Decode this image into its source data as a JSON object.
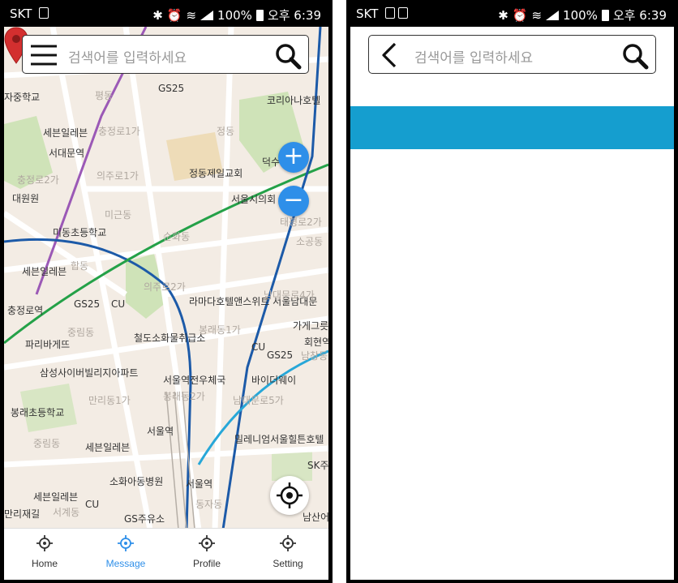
{
  "status_bar": {
    "carrier": "SKT",
    "battery": "100%",
    "time": "오후 6:39"
  },
  "left_screen": {
    "menu_icon": "hamburger-icon",
    "search_placeholder": "검색어를 입력하세요",
    "search_icon": "magnifier-icon",
    "zoom_in_label": "+",
    "zoom_out_label": "−",
    "map_labels": [
      "GS25",
      "코리아나호텔",
      "세븐일레븐",
      "서대문역",
      "정동제일교회",
      "서울시의회",
      "대원원",
      "미근동",
      "미동초등학교",
      "순화동",
      "세븐일레븐",
      "충정로역",
      "GS25",
      "CU",
      "라마다호텔앤스위트 서울남대문",
      "중림동",
      "파리바게뜨",
      "철도소화물취급소",
      "가게그릇",
      "회현역",
      "CU",
      "GS25",
      "삼성사이버빌리지아파트",
      "서울역전우체국",
      "바이더웨이",
      "만리동1가",
      "봉래초등학교",
      "서울역",
      "중림동",
      "세븐일레븐",
      "밀레니엄서울힐튼호텔",
      "소화아동병원",
      "서울역",
      "세븐일레븐",
      "CU",
      "GS주유소",
      "SK주",
      "남산어",
      "자중학교",
      "평동",
      "충정로1가",
      "정동",
      "덕수",
      "의주로1가",
      "충정로2가",
      "태평로2가",
      "소공동",
      "합동",
      "의주로2가",
      "남대문로4가",
      "봉래동1가",
      "남창동",
      "봉래동2가",
      "남대문로5가",
      "서계동",
      "동자동",
      "만리재길"
    ],
    "tabs": [
      {
        "label": "Home",
        "active": false
      },
      {
        "label": "Message",
        "active": true
      },
      {
        "label": "Profile",
        "active": false
      },
      {
        "label": "Setting",
        "active": false
      }
    ]
  },
  "right_screen": {
    "back_icon": "back-chevron-icon",
    "search_placeholder": "검색어를 입력하세요",
    "search_icon": "magnifier-icon",
    "band_color": "#159ecf"
  },
  "colors": {
    "accent": "#2e8fe9",
    "pin": "#d32f2f"
  }
}
